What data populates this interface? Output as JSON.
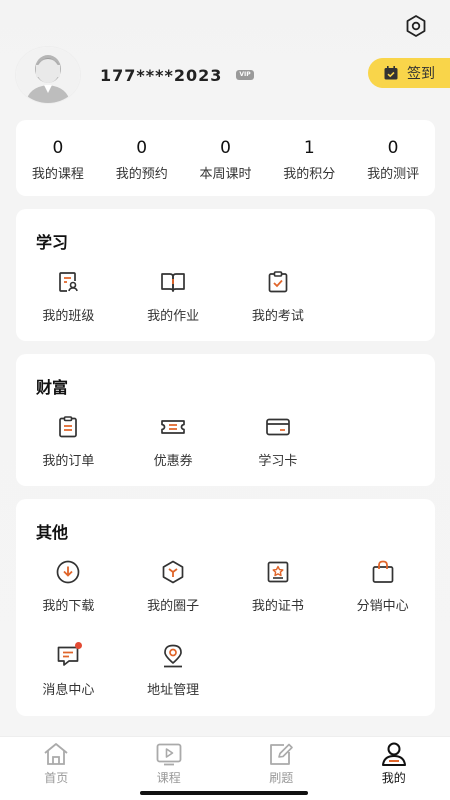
{
  "profile": {
    "phone": "177****2023",
    "vip": "VIP",
    "sign_label": "签到"
  },
  "stats": [
    {
      "value": "0",
      "label": "我的课程"
    },
    {
      "value": "0",
      "label": "我的预约"
    },
    {
      "value": "0",
      "label": "本周课时"
    },
    {
      "value": "1",
      "label": "我的积分"
    },
    {
      "value": "0",
      "label": "我的测评"
    }
  ],
  "study": {
    "title": "学习",
    "items": [
      {
        "label": "我的班级",
        "icon": "class-icon"
      },
      {
        "label": "我的作业",
        "icon": "homework-icon"
      },
      {
        "label": "我的考试",
        "icon": "exam-icon"
      }
    ]
  },
  "wealth": {
    "title": "财富",
    "items": [
      {
        "label": "我的订单",
        "icon": "order-icon"
      },
      {
        "label": "优惠券",
        "icon": "coupon-icon"
      },
      {
        "label": "学习卡",
        "icon": "card-icon"
      }
    ]
  },
  "other": {
    "title": "其他",
    "items": [
      {
        "label": "我的下载",
        "icon": "download-icon"
      },
      {
        "label": "我的圈子",
        "icon": "circle-icon"
      },
      {
        "label": "我的证书",
        "icon": "certificate-icon"
      },
      {
        "label": "分销中心",
        "icon": "bag-icon"
      },
      {
        "label": "消息中心",
        "icon": "message-icon"
      },
      {
        "label": "地址管理",
        "icon": "location-icon"
      }
    ]
  },
  "tabs": [
    {
      "label": "首页",
      "icon": "home-icon"
    },
    {
      "label": "课程",
      "icon": "play-icon"
    },
    {
      "label": "刷题",
      "icon": "edit-icon"
    },
    {
      "label": "我的",
      "icon": "user-icon"
    }
  ],
  "colors": {
    "accent": "#e0652a",
    "sign_bg": "#f9d54a",
    "badge": "#e34a33"
  }
}
